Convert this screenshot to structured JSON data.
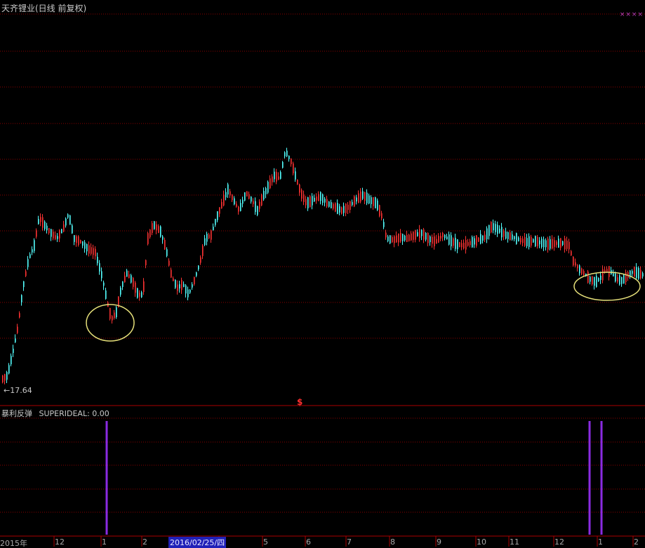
{
  "title": "天齐锂业(日线 前复权)",
  "corner_marker": "××××",
  "low_price_label": "←17.64",
  "event_marker": "$",
  "indicator": {
    "name": "暴利反弹",
    "value_label": "SUPERIDEAL: 0.00"
  },
  "highlight_date": "2016/02/25/四",
  "x_ticks": [
    "2015年",
    "12",
    "1",
    "2",
    "4",
    "5",
    "6",
    "7",
    "8",
    "9",
    "10",
    "11",
    "12",
    "1",
    "2"
  ],
  "colors": {
    "background": "#000000",
    "up_candle": "#ff3333",
    "down_candle": "#54ffff",
    "signal": "#8a2be2",
    "circle": "#e6e07a",
    "grid": "#8b0000"
  },
  "chart_data": {
    "type": "candlestick",
    "title": "天齐锂业(日线 前复权)",
    "price_series": {
      "x": [
        "2015年",
        "12",
        "1",
        "2",
        "4",
        "5",
        "6",
        "7",
        "8",
        "9",
        "10",
        "11",
        "12",
        "1",
        "2"
      ],
      "close": [
        18.2,
        41.5,
        39.0,
        30.5,
        38.0,
        52.0,
        66.0,
        56.0,
        48.5,
        46.0,
        49.0,
        45.5,
        44.0,
        36.5,
        38.0
      ]
    },
    "min_price_label": 17.64,
    "indicator_series": {
      "name": "SUPERIDEAL",
      "current_value": 0.0,
      "signals_at": [
        "1",
        "1",
        "1"
      ]
    },
    "annotations": [
      "circle around the January low",
      "circle around the final low"
    ]
  }
}
